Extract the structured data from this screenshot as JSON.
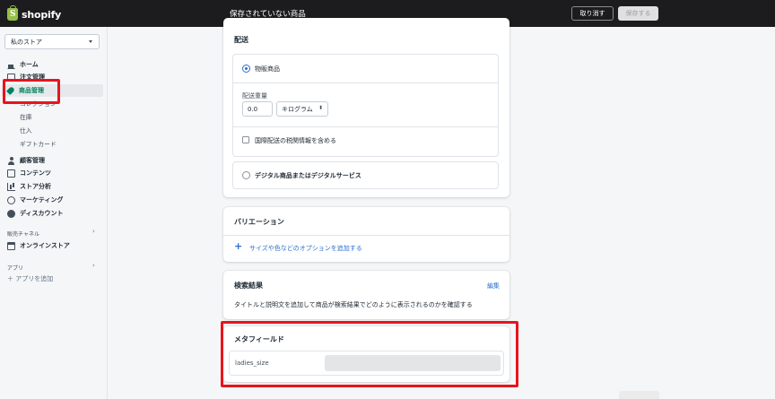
{
  "topbar": {
    "logo_text": "shopify",
    "logo_glyph": "S",
    "page_state": "保存されていない商品",
    "discard_label": "取り消す",
    "save_label": "保存する"
  },
  "sidebar": {
    "store_name": "私のストア",
    "items": [
      {
        "label": "ホーム",
        "icon": "home-icon"
      },
      {
        "label": "注文管理",
        "icon": "orders-icon"
      },
      {
        "label": "商品管理",
        "icon": "tag-icon"
      },
      {
        "label": "顧客管理",
        "icon": "person-icon"
      },
      {
        "label": "コンテンツ",
        "icon": "content-icon"
      },
      {
        "label": "ストア分析",
        "icon": "analytics-icon"
      },
      {
        "label": "マーケティング",
        "icon": "target-icon"
      },
      {
        "label": "ディスカウント",
        "icon": "discount-icon"
      }
    ],
    "product_subitems": [
      "コレクション",
      "在庫",
      "仕入",
      "ギフトカード"
    ],
    "sales_channels_label": "販売チャネル",
    "online_store_label": "オンラインストア",
    "apps_label": "アプリ",
    "add_app_label": "＋ アプリを追加"
  },
  "shipping": {
    "title": "配送",
    "physical_label": "物販商品",
    "weight_label": "配送重量",
    "weight_value": "0.0",
    "weight_unit": "キログラム",
    "customs_label": "国際配送の税関情報を含める",
    "digital_label": "デジタル商品またはデジタルサービス"
  },
  "variants": {
    "title": "バリエーション",
    "add_option_label": "サイズや色などのオプションを追加する"
  },
  "seo": {
    "title": "検索結果",
    "edit_label": "編集",
    "description": "タイトルと説明文を追加して商品が検索結果でどのように表示されるのかを確認する"
  },
  "metafields": {
    "title": "メタフィールド",
    "field_name": "ladies_size",
    "field_value": ""
  },
  "colors": {
    "accent": "#2c6ecb",
    "highlight": "#e8141c",
    "topbar": "#1c1c1e"
  }
}
